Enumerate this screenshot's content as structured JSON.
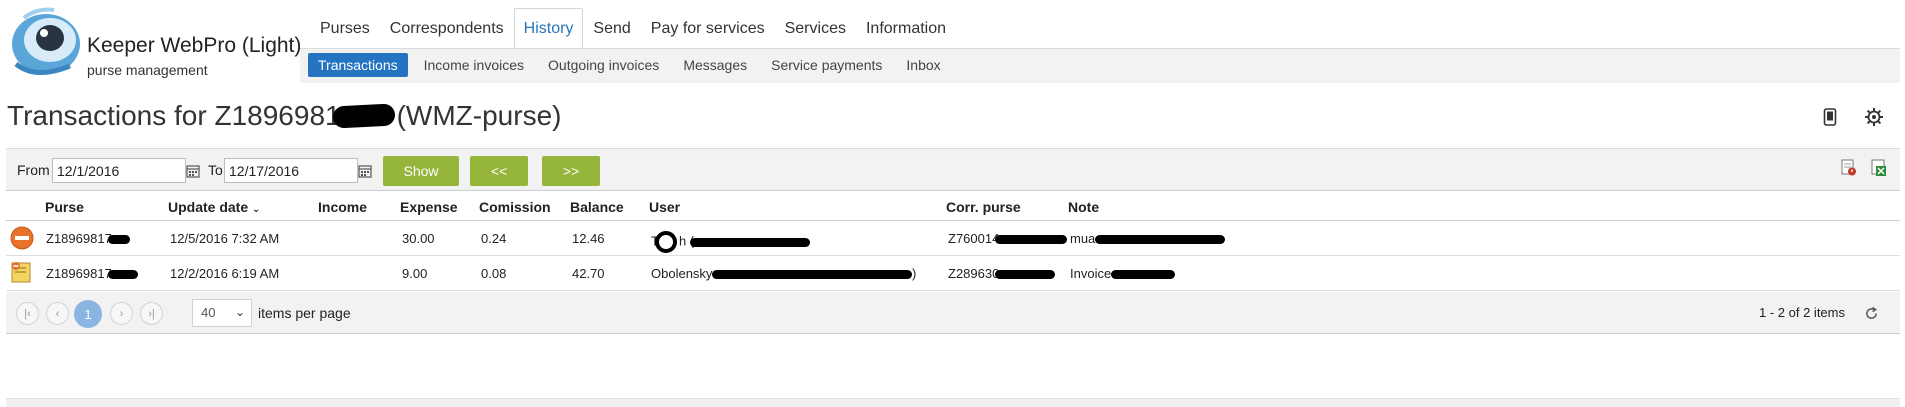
{
  "app": {
    "title": "Keeper WebPro (Light)",
    "subtitle": "purse management"
  },
  "main_nav": [
    {
      "label": "Purses",
      "active": false
    },
    {
      "label": "Correspondents",
      "active": false
    },
    {
      "label": "History",
      "active": true
    },
    {
      "label": "Send",
      "active": false
    },
    {
      "label": "Pay for services",
      "active": false
    },
    {
      "label": "Services",
      "active": false
    },
    {
      "label": "Information",
      "active": false
    }
  ],
  "sub_nav": [
    {
      "label": "Transactions",
      "active": true
    },
    {
      "label": "Income invoices",
      "active": false
    },
    {
      "label": "Outgoing invoices",
      "active": false
    },
    {
      "label": "Messages",
      "active": false
    },
    {
      "label": "Service payments",
      "active": false
    },
    {
      "label": "Inbox",
      "active": false
    }
  ],
  "page": {
    "title_prefix": "Transactions for Z1896981",
    "title_suffix": "(WMZ-purse)"
  },
  "filter": {
    "from_label": "From",
    "from_value": "12/1/2016",
    "to_label": "To",
    "to_value": "12/17/2016",
    "show_label": "Show",
    "prev_label": "<<",
    "next_label": ">>"
  },
  "columns": {
    "purse": "Purse",
    "update_date": "Update date",
    "income": "Income",
    "expense": "Expense",
    "comission": "Comission",
    "balance": "Balance",
    "user": "User",
    "corr_purse": "Corr. purse",
    "note": "Note"
  },
  "rows": [
    {
      "type": "expense",
      "purse": "Z18969817",
      "update_date": "12/5/2016 7:32 AM",
      "income": "",
      "expense": "30.00",
      "comission": "0.24",
      "balance": "12.46",
      "user": "T",
      "user_tail": "h (",
      "corr_purse": "Z760014",
      "note": "mua"
    },
    {
      "type": "invoice",
      "purse": "Z18969817",
      "update_date": "12/2/2016 6:19 AM",
      "income": "",
      "expense": "9.00",
      "comission": "0.08",
      "balance": "42.70",
      "user": "Obolensky",
      "user_tail": ")",
      "corr_purse": "Z289630",
      "note": "Invoice"
    }
  ],
  "pager": {
    "current_page": "1",
    "page_size": "40",
    "items_per_page_label": "items per page",
    "info": "1 - 2 of 2 items"
  },
  "colors": {
    "accent_blue": "#2474c1",
    "action_green": "#95b53b",
    "toolbar_gray": "#f2f2f2"
  }
}
